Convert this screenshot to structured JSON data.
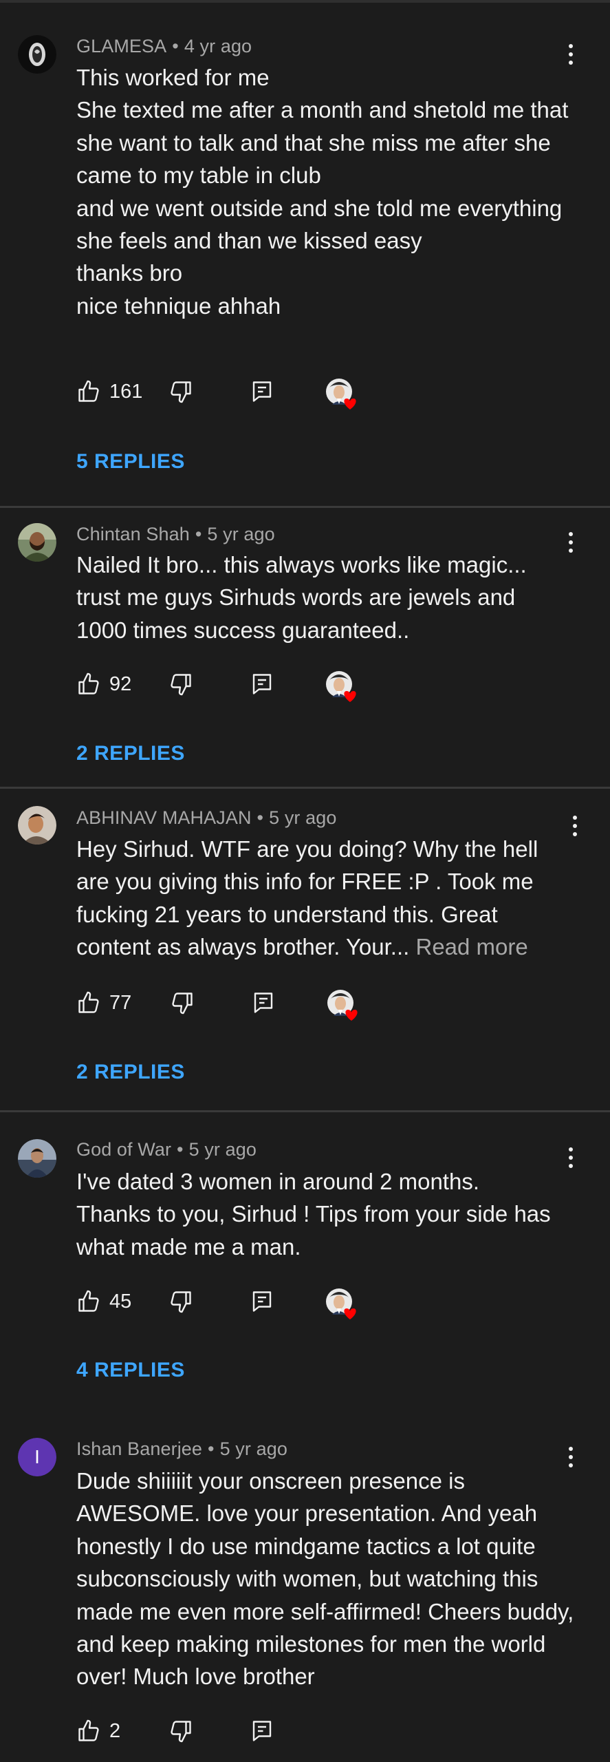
{
  "comments": [
    {
      "author": "GLAMESA",
      "time": "4 yr ago",
      "text": "This worked for me\nShe texted me after a month and shetold me that she want to talk and that she miss me after she came to my table in club\nand we went outside and she told me everything she feels and than we kissed easy\nthanks bro\nnice tehnique ahhah",
      "read_more": "",
      "likes": "161",
      "replies": "5 REPLIES",
      "creator_heart": true
    },
    {
      "author": "Chintan Shah",
      "time": "5 yr ago",
      "text": "Nailed It bro... this always works like magic... trust me guys Sirhuds words are jewels and 1000 times success guaranteed..",
      "read_more": "",
      "likes": "92",
      "replies": "2 REPLIES",
      "creator_heart": true
    },
    {
      "author": "ABHINAV MAHAJAN",
      "time": "5 yr ago",
      "text": "Hey Sirhud. WTF are you doing? Why the hell are you giving this info for FREE :P . Took me fucking 21 years to understand this. Great content as always brother. Your... ",
      "read_more": "Read more",
      "likes": "77",
      "replies": "2 REPLIES",
      "creator_heart": true
    },
    {
      "author": "God of War",
      "time": "5 yr ago",
      "text": "I've dated 3 women in around 2 months. Thanks to you, Sirhud ! Tips from your side has what made me a man.",
      "read_more": "",
      "likes": "45",
      "replies": "4 REPLIES",
      "creator_heart": true
    },
    {
      "author": "Ishan Banerjee",
      "avatar_letter": "I",
      "time": "5 yr ago",
      "text": "Dude shiiiiit your onscreen presence is AWESOME. love your presentation. And yeah honestly I do use mindgame tactics a lot quite subconsciously with women, but watching this made me even more self-affirmed! Cheers buddy, and keep making milestones for men the world over! Much love brother",
      "read_more": "",
      "likes": "2",
      "replies": "",
      "creator_heart": false
    }
  ],
  "separator": "•",
  "icons": {
    "like": "thumbs-up-icon",
    "dislike": "thumbs-down-icon",
    "reply": "reply-icon",
    "more": "more-vert-icon",
    "heart": "creator-heart-icon"
  },
  "colors": {
    "background": "#1c1c1c",
    "link": "#3ea6ff",
    "heart": "#ff0000",
    "muted": "#a8a8a8"
  }
}
